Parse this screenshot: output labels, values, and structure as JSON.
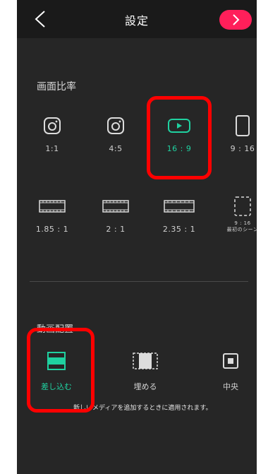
{
  "header": {
    "title": "設定",
    "back_icon": "chevron-left-icon",
    "next_icon": "chevron-right-icon",
    "next_color": "#ff1f5a"
  },
  "aspect_ratio": {
    "title": "画面比率",
    "options": [
      {
        "label": "1:1",
        "icon": "instagram-icon",
        "selected": false
      },
      {
        "label": "4:5",
        "icon": "instagram-icon",
        "selected": false
      },
      {
        "label": "16 : 9",
        "icon": "youtube-play-icon",
        "selected": true
      },
      {
        "label": "9 : 16",
        "icon": "portrait-rect-icon",
        "selected": false
      },
      {
        "label": "1.85 : 1",
        "icon": "film-strip-icon",
        "selected": false
      },
      {
        "label": "2 : 1",
        "icon": "film-strip-icon",
        "selected": false
      },
      {
        "label": "2.35 : 1",
        "icon": "film-strip-icon",
        "selected": false
      },
      {
        "label": "9 : 16",
        "sublabel": "最初のシーン",
        "icon": "dashed-rect-icon",
        "selected": false
      }
    ]
  },
  "video_placement": {
    "title": "動画配置",
    "options": [
      {
        "label": "差し込む",
        "icon": "fit-icon",
        "selected": true
      },
      {
        "label": "埋める",
        "icon": "fill-icon",
        "selected": false
      },
      {
        "label": "中央",
        "icon": "center-icon",
        "selected": false
      }
    ],
    "note": "新しいメディアを追加するときに適用されます。"
  },
  "colors": {
    "accent": "#1fd1a0",
    "highlight": "#ff0000",
    "background": "#262626"
  }
}
